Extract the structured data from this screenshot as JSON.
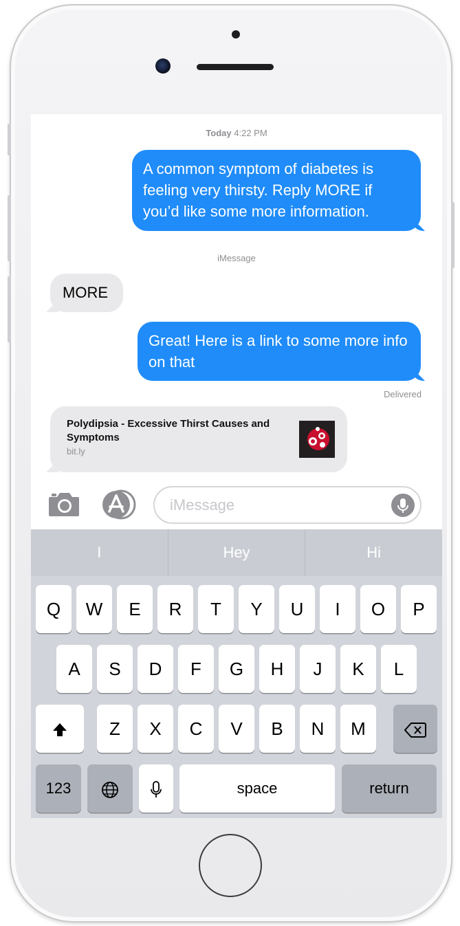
{
  "conversation": {
    "timestamp_day": "Today",
    "timestamp_time": "4:22 PM",
    "messages": [
      {
        "direction": "outgoing",
        "text": "A common symptom of diabetes is feeling very thirsty. Reply MORE if you’d like some more information."
      },
      {
        "direction": "incoming",
        "text": "MORE"
      },
      {
        "direction": "outgoing",
        "text": "Great! Here is a link to some more info on that"
      }
    ],
    "service_label": "iMessage",
    "delivery_status": "Delivered",
    "link_preview": {
      "title": "Polydipsia - Excessive Thirst Causes and Symptoms",
      "domain": "bit.ly"
    }
  },
  "input_bar": {
    "placeholder": "iMessage",
    "camera_icon": "camera-icon",
    "apps_icon": "app-store-icon",
    "mic_icon": "microphone-icon"
  },
  "keyboard": {
    "predictions": [
      "I",
      "Hey",
      "Hi"
    ],
    "row1": [
      "Q",
      "W",
      "E",
      "R",
      "T",
      "Y",
      "U",
      "I",
      "O",
      "P"
    ],
    "row2": [
      "A",
      "S",
      "D",
      "F",
      "G",
      "H",
      "J",
      "K",
      "L"
    ],
    "row3": [
      "Z",
      "X",
      "C",
      "V",
      "B",
      "N",
      "M"
    ],
    "numbers_label": "123",
    "space_label": "space",
    "return_label": "return"
  },
  "colors": {
    "outgoing_bubble": "#1f8cf9",
    "incoming_bubble": "#e9e9eb",
    "keyboard_bg": "#d1d4da"
  }
}
